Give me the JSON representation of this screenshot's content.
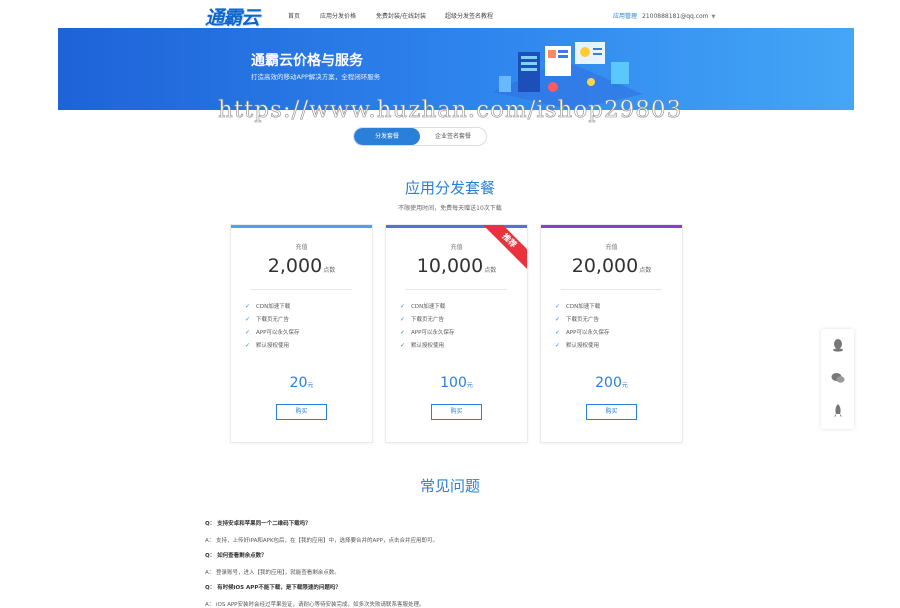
{
  "header": {
    "logo": "通霸云",
    "nav": [
      "首页",
      "应用分发价格",
      "免费封装/在线封装",
      "超级分发签名教程"
    ],
    "user_center": "应用管理",
    "user_email": "2100888181@qq.com"
  },
  "banner": {
    "title": "通霸云价格与服务",
    "subtitle": "打造高效的移动APP解决方案，全程闭环服务"
  },
  "watermark": "https://www.huzhan.com/ishop29803",
  "tabs": [
    {
      "label": "分发套餐",
      "active": true
    },
    {
      "label": "企业签名套餐",
      "active": false
    }
  ],
  "section": {
    "title": "应用分发套餐",
    "subtitle": "不限使用时间，免费每天赠送10次下载"
  },
  "plans": [
    {
      "caption": "充值",
      "amount": "2,000",
      "unit": "点数",
      "features": [
        "CDN加速下载",
        "下载页无广告",
        "APP可以永久保存",
        "默认授权使用"
      ],
      "price": "20",
      "price_unit": "元",
      "button": "购买",
      "accent": "#4aa3ec",
      "badge": ""
    },
    {
      "caption": "充值",
      "amount": "10,000",
      "unit": "点数",
      "features": [
        "CDN加速下载",
        "下载页无广告",
        "APP可以永久保存",
        "默认授权使用"
      ],
      "price": "100",
      "price_unit": "元",
      "button": "购买",
      "accent": "#5b6ed8",
      "badge": "推荐"
    },
    {
      "caption": "充值",
      "amount": "20,000",
      "unit": "点数",
      "features": [
        "CDN加速下载",
        "下载页无广告",
        "APP可以永久保存",
        "默认授权使用"
      ],
      "price": "200",
      "price_unit": "元",
      "button": "购买",
      "accent": "#8a3fc7",
      "badge": ""
    }
  ],
  "faq": {
    "title": "常见问题",
    "items": [
      {
        "q": "Q： 支持安卓和苹果同一个二维码下载吗？",
        "a": "A： 支持，上传好IPA和APK包后，在【我的应用】中，选择要合并的APP，点击合并应用即可。"
      },
      {
        "q": "Q： 如何查看剩余点数？",
        "a": "A： 登录账号，进入【我的应用】，就能查看剩余点数。"
      },
      {
        "q": "Q： 有时候iOS APP不能下载，是下载限速的问题吗？",
        "a": "A： iOS APP安装时会经过苹果验证，请耐心等待安装完成，如多次失败请联系客服处理。"
      }
    ]
  },
  "side": {
    "icons": [
      "qq-icon",
      "wechat-icon",
      "rocket-icon"
    ]
  },
  "colors": {
    "primary": "#2a7fd9",
    "ribbon": "#e8323c"
  }
}
